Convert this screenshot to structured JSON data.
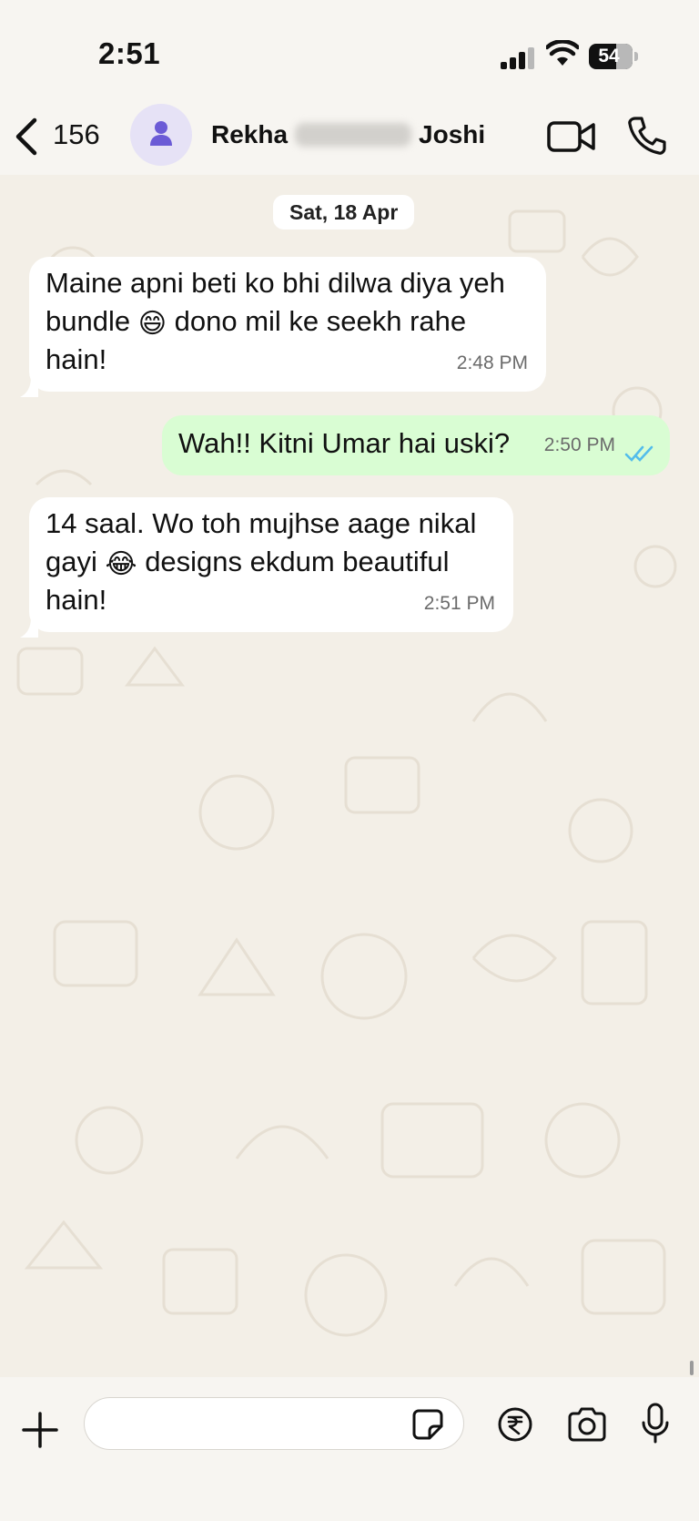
{
  "status_bar": {
    "time": "2:51",
    "battery": "54"
  },
  "header": {
    "back_count": "156",
    "contact_first": "Rekha",
    "contact_last": "Joshi"
  },
  "chat": {
    "date_chip": "Sat, 18 Apr",
    "messages": [
      {
        "direction": "incoming",
        "line1": "Maine apni beti ko bhi dilwa diya yeh",
        "line2a": "bundle",
        "emoji": "😄",
        "line2b": "dono mil ke seekh rahe",
        "line3": "hain!",
        "time": "2:48 PM"
      },
      {
        "direction": "outgoing",
        "text": "Wah!! Kitni Umar hai uski?",
        "time": "2:50 PM",
        "status": "read"
      },
      {
        "direction": "incoming",
        "line1": "14 saal. Wo toh mujhse aage nikal",
        "line2a": "gayi",
        "emoji": "😂",
        "line2b": "designs ekdum beautiful",
        "line3": "hain!",
        "time": "2:51 PM"
      }
    ]
  },
  "colors": {
    "outgoing_bubble": "#d9fdd3",
    "read_ticks": "#53bdeb",
    "avatar_icon": "#6b5bd6",
    "chat_background": "#f3efe7"
  },
  "icons": [
    "back-icon",
    "avatar-icon",
    "video-call-icon",
    "voice-call-icon",
    "plus-icon",
    "sticker-icon",
    "rupee-icon",
    "camera-icon",
    "microphone-icon"
  ]
}
